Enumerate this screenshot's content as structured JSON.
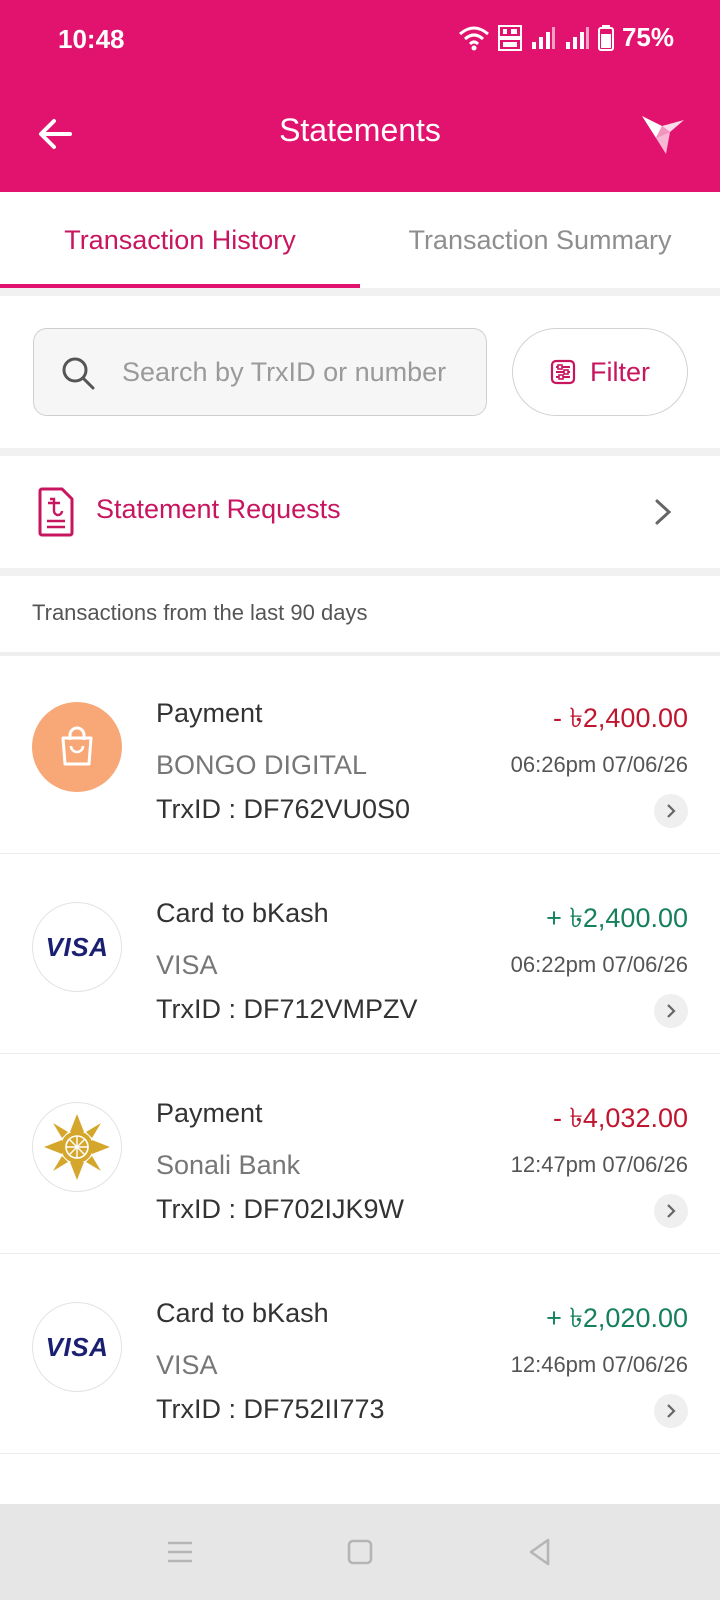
{
  "status_bar": {
    "time": "10:48",
    "battery": "75%",
    "icons": [
      "wifi-icon",
      "volte-icon",
      "signal-icon",
      "signal-icon",
      "battery-icon"
    ]
  },
  "app_bar": {
    "title": "Statements",
    "back_icon": "arrow-left-icon",
    "logo_icon": "bkash-bird-icon"
  },
  "tabs": [
    {
      "label": "Transaction History",
      "active": true
    },
    {
      "label": "Transaction Summary",
      "active": false
    }
  ],
  "search": {
    "placeholder": "Search by TrxID or number",
    "value": ""
  },
  "filter": {
    "label": "Filter",
    "icon": "sliders-icon"
  },
  "statement_requests": {
    "label": "Statement Requests",
    "icon": "taka-document-icon"
  },
  "range_note": "Transactions from the last 90 days",
  "transactions": [
    {
      "type": "Payment",
      "party": "BONGO DIGITAL",
      "trx": "TrxID : DF762VU0S0",
      "amount": "- ৳2,400.00",
      "direction": "debit",
      "datetime": "06:26pm 07/06/26",
      "avatar": "shopping-bag-icon"
    },
    {
      "type": "Card to bKash",
      "party": "VISA",
      "trx": "TrxID : DF712VMPZV",
      "amount": "+ ৳2,400.00",
      "direction": "credit",
      "datetime": "06:22pm 07/06/26",
      "avatar": "VISA"
    },
    {
      "type": "Payment",
      "party": "Sonali Bank",
      "trx": "TrxID : DF702IJK9W",
      "amount": "- ৳4,032.00",
      "direction": "debit",
      "datetime": "12:47pm 07/06/26",
      "avatar": "sonali-bank-logo"
    },
    {
      "type": "Card to bKash",
      "party": "VISA",
      "trx": "TrxID : DF752II773",
      "amount": "+ ৳2,020.00",
      "direction": "credit",
      "datetime": "12:46pm 07/06/26",
      "avatar": "VISA"
    }
  ],
  "colors": {
    "brand": "#e2136e",
    "debit": "#c0152f",
    "credit": "#15805a"
  }
}
